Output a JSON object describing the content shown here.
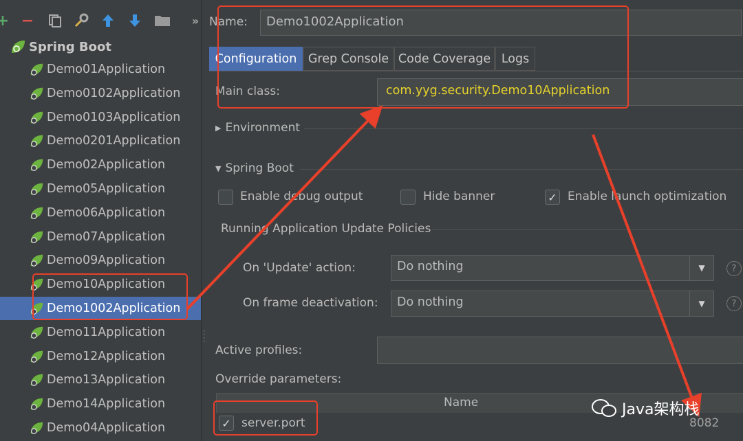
{
  "toolbar": {
    "icons": [
      "add-icon",
      "remove-icon",
      "copy-icon",
      "wrench-icon",
      "move-up-icon",
      "move-down-icon",
      "folder-icon",
      "more-icon"
    ],
    "more_label": "»"
  },
  "tree": {
    "root_label": "Spring Boot",
    "items": [
      {
        "label": "Demo01Application"
      },
      {
        "label": "Demo0102Application"
      },
      {
        "label": "Demo0103Application"
      },
      {
        "label": "Demo0201Application"
      },
      {
        "label": "Demo02Application"
      },
      {
        "label": "Demo05Application"
      },
      {
        "label": "Demo06Application"
      },
      {
        "label": "Demo07Application"
      },
      {
        "label": "Demo09Application"
      },
      {
        "label": "Demo10Application"
      },
      {
        "label": "Demo1002Application"
      },
      {
        "label": "Demo11Application"
      },
      {
        "label": "Demo12Application"
      },
      {
        "label": "Demo13Application"
      },
      {
        "label": "Demo14Application"
      },
      {
        "label": "Demo04Application"
      }
    ],
    "selected_index": 10
  },
  "form": {
    "name_label": "Name:",
    "name_value": "Demo1002Application",
    "tabs": [
      "Configuration",
      "Grep Console",
      "Code Coverage",
      "Logs"
    ],
    "active_tab": 0,
    "main_class_label": "Main class:",
    "main_class_value": "com.yyg.security.Demo10Application",
    "environment_label": "Environment",
    "spring_boot_label": "Spring Boot",
    "enable_debug_label": "Enable debug output",
    "enable_debug_checked": false,
    "hide_banner_label": "Hide banner",
    "hide_banner_checked": false,
    "launch_opt_label": "Enable launch optimization",
    "launch_opt_checked": true,
    "policies_label": "Running Application Update Policies",
    "on_update_label": "On 'Update' action:",
    "on_update_value": "Do nothing",
    "on_frame_label": "On frame deactivation:",
    "on_frame_value": "Do nothing",
    "help_glyph": "?",
    "active_profiles_label": "Active profiles:",
    "override_label": "Override parameters:",
    "table_header": "Name",
    "param_name": "server.port",
    "param_value": "8082",
    "param_checked": true
  },
  "watermark": {
    "text": "Java架构栈"
  },
  "colors": {
    "accent": "#4b6eaf",
    "annotation": "#e8402a",
    "main_class_text": "#e6d22a"
  }
}
